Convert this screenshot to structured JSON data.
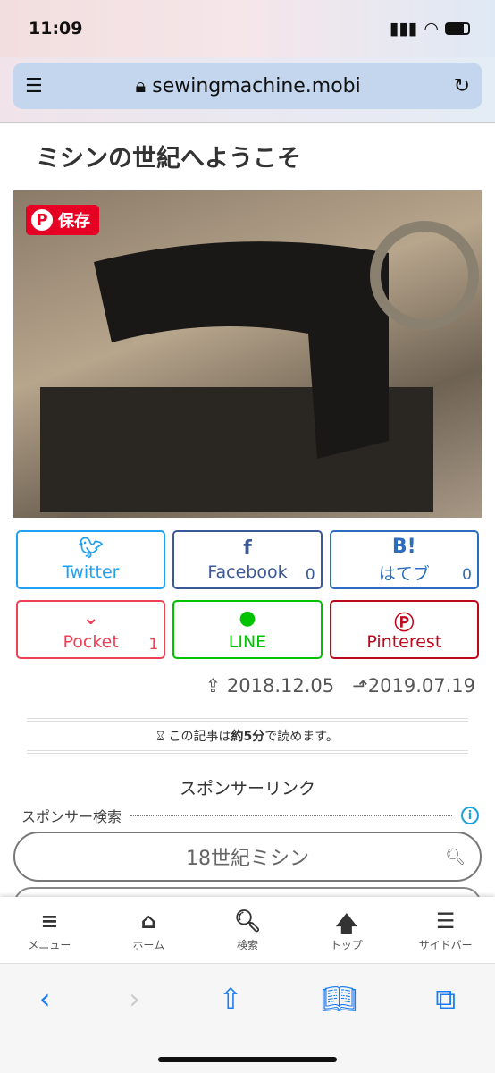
{
  "status": {
    "time": "11:09"
  },
  "browser": {
    "url": "sewingmachine.mobi"
  },
  "page": {
    "title": "ミシンの世紀へようこそ",
    "pin_save": "保存"
  },
  "share": [
    {
      "label": "Twitter",
      "icon": "twitter-icon",
      "color": "#1da1f2",
      "count": ""
    },
    {
      "label": "Facebook",
      "icon": "facebook-icon",
      "color": "#3b5998",
      "count": "0"
    },
    {
      "label": "はてブ",
      "icon": "hatena-icon",
      "color": "#2c6ebd",
      "count": "0"
    },
    {
      "label": "Pocket",
      "icon": "pocket-icon",
      "color": "#ef4056",
      "count": "1"
    },
    {
      "label": "LINE",
      "icon": "line-icon",
      "color": "#00c300",
      "count": ""
    },
    {
      "label": "Pinterest",
      "icon": "pinterest-icon",
      "color": "#bd081c",
      "count": ""
    }
  ],
  "dates": {
    "published": "2018.12.05",
    "updated": "2019.07.19"
  },
  "reading": {
    "pre": "この記事は",
    "bold": "約5分",
    "post": "で読めます。"
  },
  "sponsor": {
    "heading": "スポンサーリンク",
    "search_label": "スポンサー検索",
    "search_value": "18世紀ミシン"
  },
  "tabbar": [
    {
      "label": "メニュー",
      "icon": "≡"
    },
    {
      "label": "ホーム",
      "icon": "⌂"
    },
    {
      "label": "検索",
      "icon": "🔍︎"
    },
    {
      "label": "トップ",
      "icon": "🡅"
    },
    {
      "label": "サイドバー",
      "icon": "☰"
    }
  ]
}
